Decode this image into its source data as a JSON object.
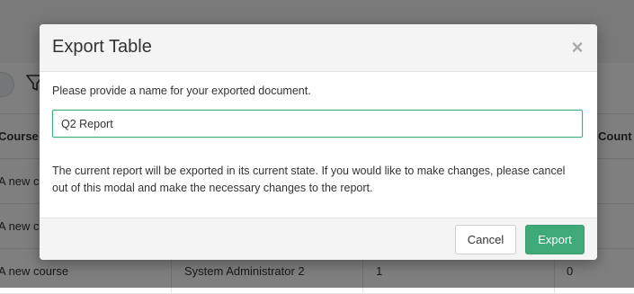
{
  "background": {
    "table_headers": {
      "course": "Course",
      "count": "Count"
    },
    "rows": [
      {
        "course": "A new course",
        "admin": "",
        "count1": "",
        "count2": ""
      },
      {
        "course": "A new course",
        "admin": "",
        "count1": "",
        "count2": ""
      },
      {
        "course": "A new course",
        "admin": "System Administrator 2",
        "count1": "1",
        "count2": "0"
      }
    ]
  },
  "modal": {
    "title": "Export Table",
    "close_symbol": "×",
    "prompt": "Please provide a name for your exported document.",
    "name_input": {
      "value": "Q2 Report",
      "placeholder": ""
    },
    "note": "The current report will be exported in its current state. If you would like to make changes, please cancel out of this modal and make the necessary changes to the report.",
    "cancel_label": "Cancel",
    "export_label": "Export"
  },
  "colors": {
    "accent": "#3fa97a",
    "input_focus_border": "#3bb07c",
    "overlay": "rgba(0,0,0,0.5)"
  },
  "icons": {
    "filter": "filter-icon",
    "close": "close-icon"
  }
}
